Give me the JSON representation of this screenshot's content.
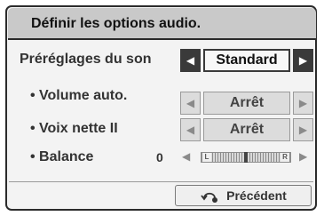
{
  "header": {
    "title": "Définir les options audio."
  },
  "rows": {
    "presets": {
      "label": "Préréglages du son",
      "value": "Standard"
    },
    "auto_volume": {
      "label": "• Volume auto.",
      "value": "Arrêt"
    },
    "clear_voice": {
      "label": "• Voix nette II",
      "value": "Arrêt"
    },
    "balance": {
      "label": "• Balance",
      "value": "0",
      "left_tag": "L",
      "right_tag": "R",
      "position": 0.5
    }
  },
  "footer": {
    "back_label": "Précédent"
  },
  "icons": {
    "prev": "triangle-left-icon",
    "next": "triangle-right-icon",
    "back": "return-arrow-icon"
  }
}
